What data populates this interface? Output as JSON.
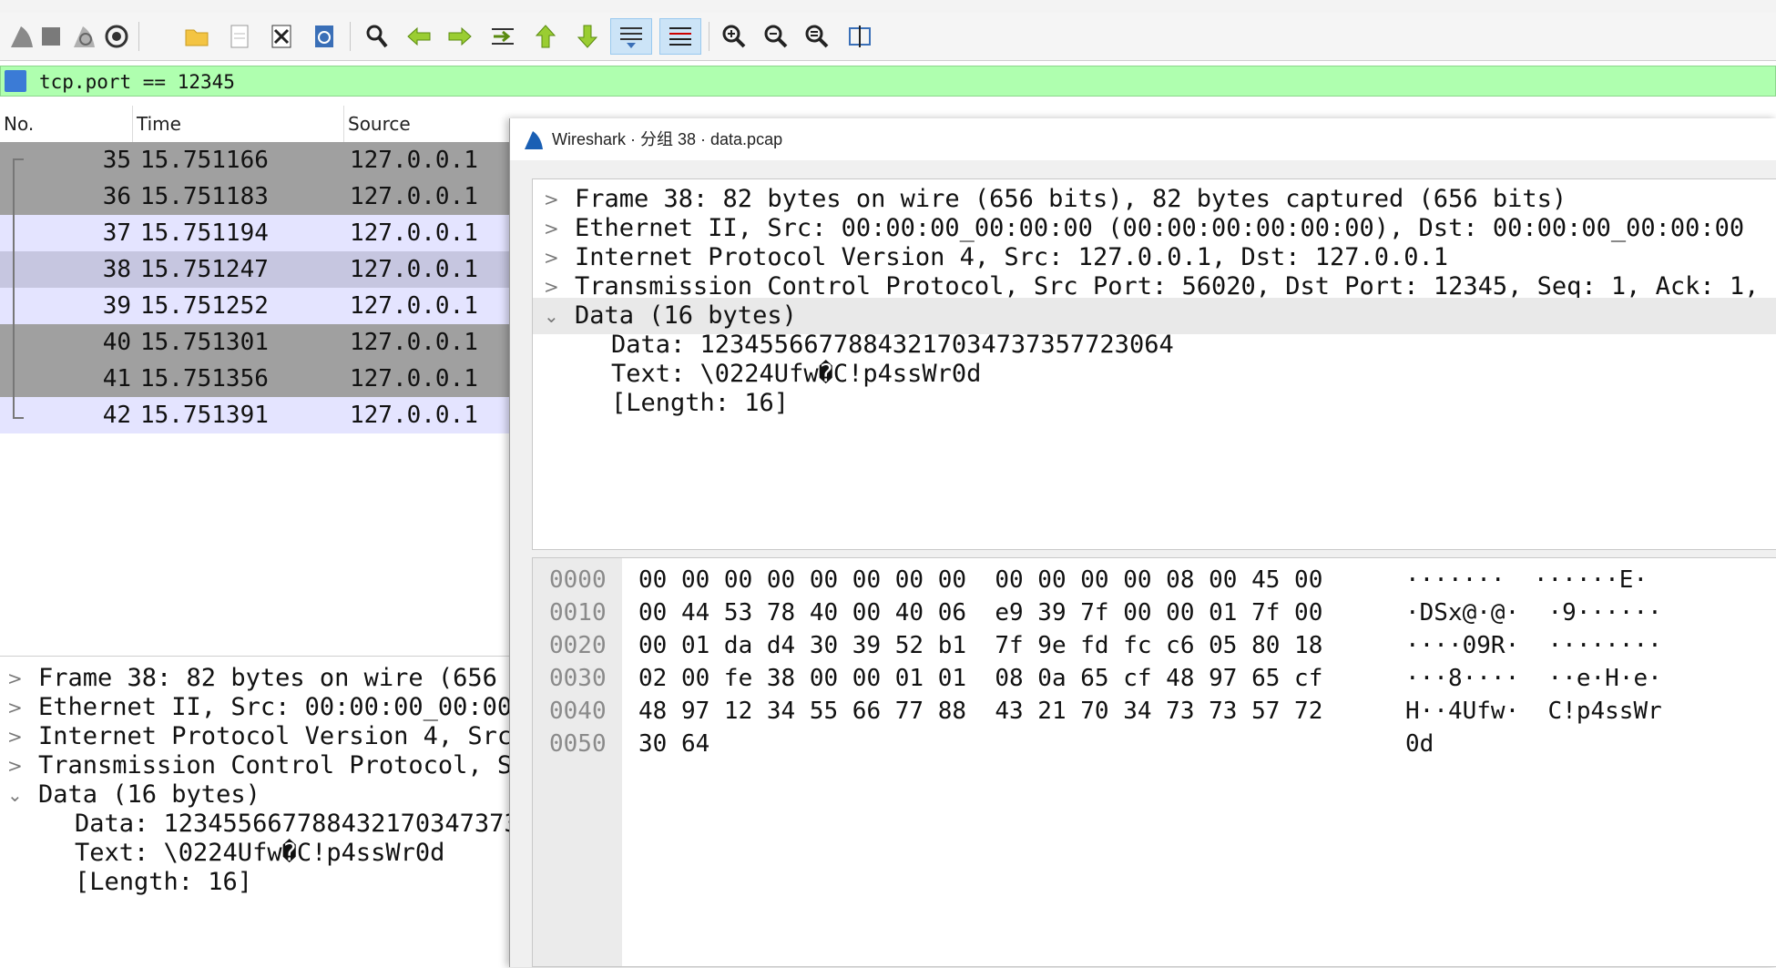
{
  "toolbar": {
    "icons": [
      "shark-fin-start-icon",
      "stop-icon",
      "restart-icon",
      "options-gear-icon",
      "open-folder-icon",
      "save-file-icon",
      "close-file-icon",
      "reload-icon",
      "find-icon",
      "go-back-icon",
      "go-forward-icon",
      "go-to-packet-icon",
      "first-packet-icon",
      "last-packet-icon",
      "autoscroll-icon",
      "colorize-icon",
      "zoom-in-icon",
      "zoom-out-icon",
      "normal-size-icon",
      "resize-columns-icon"
    ]
  },
  "filter": {
    "value": "tcp.port == 12345",
    "background": "#afffaf"
  },
  "packet_list": {
    "columns": [
      "No.",
      "Time",
      "Source"
    ],
    "rows": [
      {
        "no": "35",
        "time": "15.751166",
        "source": "127.0.0.1",
        "style": "dark"
      },
      {
        "no": "36",
        "time": "15.751183",
        "source": "127.0.0.1",
        "style": "dark"
      },
      {
        "no": "37",
        "time": "15.751194",
        "source": "127.0.0.1",
        "style": "light"
      },
      {
        "no": "38",
        "time": "15.751247",
        "source": "127.0.0.1",
        "style": "selected"
      },
      {
        "no": "39",
        "time": "15.751252",
        "source": "127.0.0.1",
        "style": "light"
      },
      {
        "no": "40",
        "time": "15.751301",
        "source": "127.0.0.1",
        "style": "dark"
      },
      {
        "no": "41",
        "time": "15.751356",
        "source": "127.0.0.1",
        "style": "dark"
      },
      {
        "no": "42",
        "time": "15.751391",
        "source": "127.0.0.1",
        "style": "light"
      }
    ]
  },
  "main_detail": {
    "rows": [
      "Frame 38: 82 bytes on wire (656",
      "Ethernet II, Src: 00:00:00_00:00",
      "Internet Protocol Version 4, Src",
      "Transmission Control Protocol, S",
      "Data (16 bytes)"
    ],
    "children": [
      "Data: 123455667788432170347373",
      "Text: \\0224Ufw�C!p4ssWr0d",
      "[Length: 16]"
    ]
  },
  "popup": {
    "title": "Wireshark · 分组 38 · data.pcap",
    "tree": [
      "Frame 38: 82 bytes on wire (656 bits), 82 bytes captured (656 bits)",
      "Ethernet II, Src: 00:00:00_00:00:00 (00:00:00:00:00:00), Dst: 00:00:00_00:00:00",
      "Internet Protocol Version 4, Src: 127.0.0.1, Dst: 127.0.0.1",
      "Transmission Control Protocol, Src Port: 56020, Dst Port: 12345, Seq: 1, Ack: 1,",
      "Data (16 bytes)"
    ],
    "tree_children": [
      "Data: 12345566778843217034737357723064",
      "Text: \\0224Ufw�C!p4ssWr0d",
      "[Length: 16]"
    ],
    "hex": [
      {
        "offset": "0000",
        "bytes": "00 00 00 00 00 00 00 00  00 00 00 00 08 00 45 00",
        "ascii": "·······  ······E·"
      },
      {
        "offset": "0010",
        "bytes": "00 44 53 78 40 00 40 06  e9 39 7f 00 00 01 7f 00",
        "ascii": "·DSx@·@·  ·9······"
      },
      {
        "offset": "0020",
        "bytes": "00 01 da d4 30 39 52 b1  7f 9e fd fc c6 05 80 18",
        "ascii": "····09R·  ········"
      },
      {
        "offset": "0030",
        "bytes": "02 00 fe 38 00 00 01 01  08 0a 65 cf 48 97 65 cf",
        "ascii": "···8····  ··e·H·e·"
      },
      {
        "offset": "0040",
        "bytes": "48 97 12 34 55 66 77 88  43 21 70 34 73 73 57 72",
        "ascii": "H··4Ufw·  C!p4ssWr"
      },
      {
        "offset": "0050",
        "bytes": "30 64",
        "ascii": "0d"
      }
    ]
  }
}
